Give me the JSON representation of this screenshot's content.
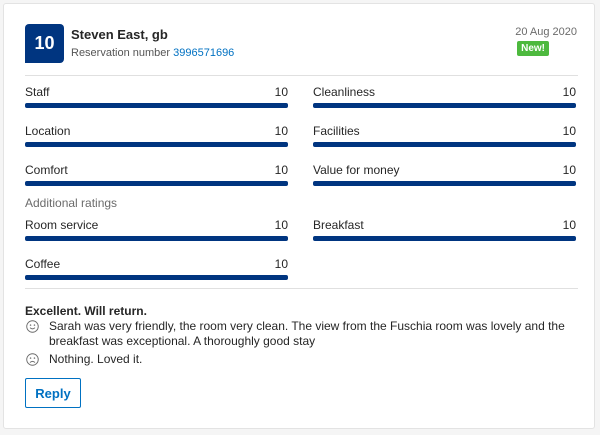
{
  "review": {
    "score": "10",
    "guest_name": "Steven East, gb",
    "reservation_label": "Reservation number",
    "reservation_number": "3996571696",
    "date": "20 Aug 2020",
    "badge": "New!",
    "title": "Excellent. Will return.",
    "positive": "Sarah was very friendly, the room very clean. The view from the Fuschia room was lovely and the breakfast was exceptional. A thoroughly good stay",
    "negative": "Nothing. Loved it.",
    "positive_icon": "smile-icon",
    "negative_icon": "frown-icon"
  },
  "ratings": [
    {
      "label": "Staff",
      "value": "10",
      "fraction": 1.0
    },
    {
      "label": "Cleanliness",
      "value": "10",
      "fraction": 1.0
    },
    {
      "label": "Location",
      "value": "10",
      "fraction": 1.0
    },
    {
      "label": "Facilities",
      "value": "10",
      "fraction": 1.0
    },
    {
      "label": "Comfort",
      "value": "10",
      "fraction": 1.0
    },
    {
      "label": "Value for money",
      "value": "10",
      "fraction": 1.0
    }
  ],
  "additional_heading": "Additional ratings",
  "additional_ratings": [
    {
      "label": "Room service",
      "value": "10",
      "fraction": 1.0
    },
    {
      "label": "Breakfast",
      "value": "10",
      "fraction": 1.0
    },
    {
      "label": "Coffee",
      "value": "10",
      "fraction": 1.0
    }
  ],
  "actions": {
    "reply_label": "Reply"
  },
  "colors": {
    "score_bg": "#003580",
    "bar_fill": "#003580",
    "link": "#0071c2",
    "badge_bg": "#4db93e"
  }
}
